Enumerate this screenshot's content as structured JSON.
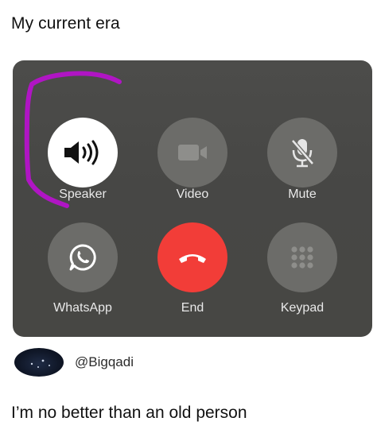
{
  "post": {
    "caption_top": "My current era",
    "handle": "@Bigqadi",
    "caption_bottom": "I’m no better than an old person"
  },
  "call_controls": {
    "speaker_label": "Speaker",
    "video_label": "Video",
    "mute_label": "Mute",
    "whatsapp_label": "WhatsApp",
    "end_label": "End",
    "keypad_label": "Keypad"
  },
  "icons": {
    "speaker": "speaker-icon",
    "video": "video-camera-icon",
    "mute": "microphone-muted-icon",
    "whatsapp": "whatsapp-icon",
    "end": "phone-hangup-icon",
    "keypad": "keypad-icon"
  },
  "colors": {
    "panel": "#474745",
    "button_gray": "#6c6c69",
    "speaker_active": "#ffffff",
    "end_red": "#f23d38",
    "annotation_purple": "#b015c4"
  }
}
